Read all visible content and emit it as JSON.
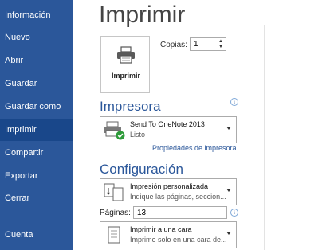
{
  "sidebar": {
    "items": [
      {
        "label": "Información",
        "active": false
      },
      {
        "label": "Nuevo",
        "active": false
      },
      {
        "label": "Abrir",
        "active": false
      },
      {
        "label": "Guardar",
        "active": false
      },
      {
        "label": "Guardar como",
        "active": false
      },
      {
        "label": "Imprimir",
        "active": true
      },
      {
        "label": "Compartir",
        "active": false
      },
      {
        "label": "Exportar",
        "active": false
      },
      {
        "label": "Cerrar",
        "active": false
      }
    ],
    "account_label": "Cuenta"
  },
  "main": {
    "title": "Imprimir",
    "print_button_label": "Imprimir",
    "copies_label": "Copias:",
    "copies_value": "1",
    "printer_section": {
      "heading": "Impresora",
      "printer_name": "Send To OneNote 2013",
      "printer_status": "Listo",
      "properties_link": "Propiedades de impresora"
    },
    "settings_section": {
      "heading": "Configuración",
      "range_main": "Impresión personalizada",
      "range_sub": "Indique las páginas, seccion...",
      "pages_label": "Páginas:",
      "pages_value": "13",
      "sides_main": "Imprimir a una cara",
      "sides_sub": "Imprime solo en una cara de..."
    }
  },
  "colors": {
    "sidebar_bg": "#2b579a",
    "sidebar_active": "#19478a",
    "accent": "#2b579a"
  }
}
